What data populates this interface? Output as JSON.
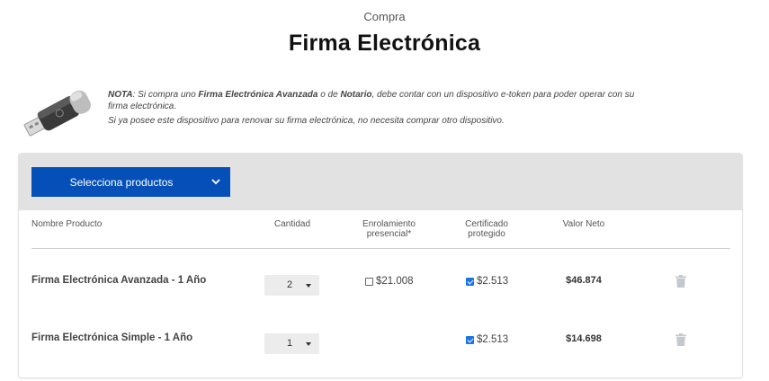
{
  "header": {
    "subtitle": "Compra",
    "title": "Firma Electrónica"
  },
  "note": {
    "label": "NOTA",
    "text_1": ": Si compra uno ",
    "bold_1": "Firma Electrónica Avanzada",
    "text_2": " o de ",
    "bold_2": "Notario",
    "text_3": ", debe contar con un dispositivo e-token para poder operar con su firma electrónica.",
    "line_2": "Si ya posee este dispositivo para renovar su firma electrónica, no necesita comprar otro dispositivo."
  },
  "product_selector": {
    "label": "Selecciona productos",
    "icon": "chevron-down-icon"
  },
  "table": {
    "columns": {
      "name": "Nombre Producto",
      "quantity": "Cantidad",
      "enrollment_1": "Enrolamiento",
      "enrollment_2": "presencial*",
      "cert_1": "Certificado",
      "cert_2": "protegido",
      "net": "Valor Neto"
    },
    "rows": [
      {
        "name": "Firma Electrónica Avanzada - 1 Año",
        "quantity": "2",
        "enrollment_checked": false,
        "enrollment_price": "$21.008",
        "cert_checked": true,
        "cert_price": "$2.513",
        "net": "$46.874"
      },
      {
        "name": "Firma Electrónica Simple - 1 Año",
        "quantity": "1",
        "cert_checked": true,
        "cert_price": "$2.513",
        "net": "$14.698"
      }
    ]
  },
  "colors": {
    "accent": "#0550b8",
    "panel": "#e2e2e2",
    "checkbox": "#1a73e8",
    "trash": "#c3c8ce"
  }
}
